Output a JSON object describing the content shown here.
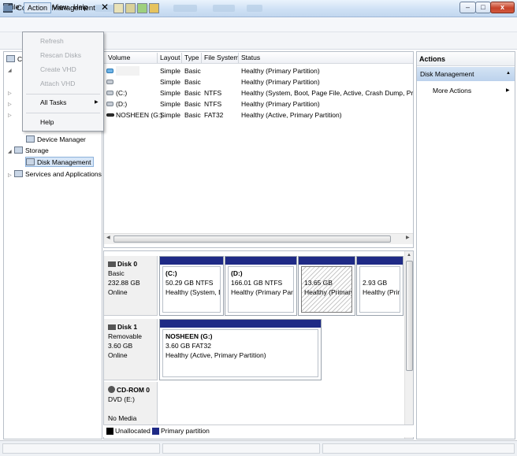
{
  "window": {
    "title": "Computer Management",
    "min_label": "–",
    "max_label": "□",
    "close_label": "x"
  },
  "menubar": {
    "file": "File",
    "action": "Action",
    "view": "View",
    "help": "Help"
  },
  "action_menu": {
    "items": [
      {
        "label": "Refresh",
        "enabled": false
      },
      {
        "label": "Rescan Disks",
        "enabled": false
      },
      {
        "label": "Create VHD",
        "enabled": false
      },
      {
        "label": "Attach VHD",
        "enabled": false
      },
      {
        "label": "All Tasks",
        "enabled": true,
        "submenu": true
      },
      {
        "label": "Help",
        "enabled": true
      }
    ]
  },
  "toolbar": {
    "delete_label": "✕"
  },
  "tree": {
    "root_label": "C",
    "device_manager": "Device Manager",
    "storage": "Storage",
    "disk_management": "Disk Management",
    "services": "Services and Applications"
  },
  "volume_list": {
    "columns": [
      "Volume",
      "Layout",
      "Type",
      "File System",
      "Status"
    ],
    "rows": [
      {
        "volume": "",
        "layout": "Simple",
        "type": "Basic",
        "fs": "",
        "status": "Healthy (Primary Partition)",
        "icon": "blue-drive-icon"
      },
      {
        "volume": "",
        "layout": "Simple",
        "type": "Basic",
        "fs": "",
        "status": "Healthy (Primary Partition)",
        "icon": "drive-icon"
      },
      {
        "volume": "(C:)",
        "layout": "Simple",
        "type": "Basic",
        "fs": "NTFS",
        "status": "Healthy (System, Boot, Page File, Active, Crash Dump, Primary",
        "icon": "drive-icon"
      },
      {
        "volume": "(D:)",
        "layout": "Simple",
        "type": "Basic",
        "fs": "NTFS",
        "status": "Healthy (Primary Partition)",
        "icon": "drive-icon"
      },
      {
        "volume": "NOSHEEN (G:)",
        "layout": "Simple",
        "type": "Basic",
        "fs": "FAT32",
        "status": "Healthy (Active, Primary Partition)",
        "icon": "usb-drive-icon"
      }
    ]
  },
  "disks": {
    "disk0": {
      "name": "Disk 0",
      "kind": "Basic",
      "size": "232.88 GB",
      "state": "Online",
      "partitions": [
        {
          "name": "(C:)",
          "size": "50.29 GB NTFS",
          "status": "Healthy (System, Boo"
        },
        {
          "name": "(D:)",
          "size": "166.01 GB NTFS",
          "status": "Healthy (Primary Partiti"
        },
        {
          "name": "",
          "size": "13.65 GB",
          "status": "Healthy (Primary I"
        },
        {
          "name": "",
          "size": "2.93 GB",
          "status": "Healthy (Prima"
        }
      ]
    },
    "disk1": {
      "name": "Disk 1",
      "kind": "Removable",
      "size": "3.60 GB",
      "state": "Online",
      "partition": {
        "name": "NOSHEEN  (G:)",
        "size": "3.60 GB FAT32",
        "status": "Healthy (Active, Primary Partition)"
      }
    },
    "cdrom0": {
      "name": "CD-ROM 0",
      "drive": "DVD (E:)",
      "media": "No Media"
    }
  },
  "legend": {
    "unallocated": "Unallocated",
    "primary": "Primary partition"
  },
  "actions": {
    "header": "Actions",
    "section": "Disk Management",
    "more": "More Actions"
  },
  "colors": {
    "primary_partition": "#1f2a86",
    "unallocated": "#000000",
    "selection": "#d7e6f7"
  }
}
